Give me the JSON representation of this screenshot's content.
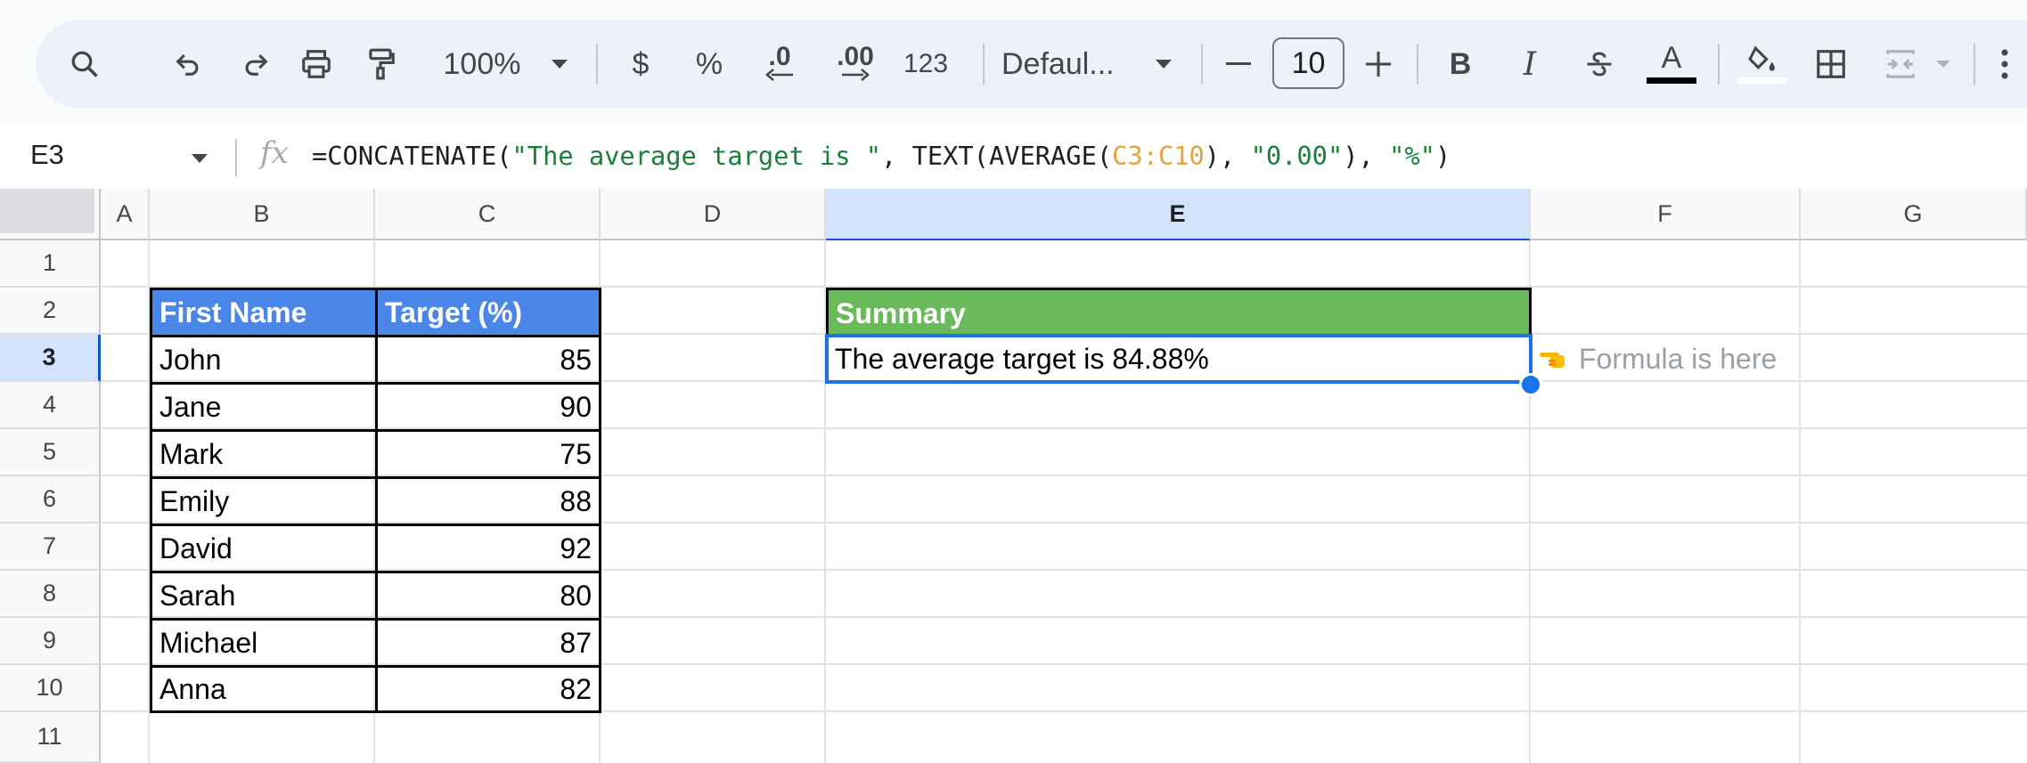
{
  "toolbar": {
    "zoom": "100%",
    "currency_label": "$",
    "percent_label": "%",
    "decrease_decimal_label": ".0",
    "increase_decimal_label": ".00",
    "number_format_label": "123",
    "font_name": "Defaul...",
    "font_size": "10",
    "bold_label": "B",
    "italic_label": "I",
    "text_color_label": "A"
  },
  "formula_bar": {
    "cell_ref": "E3",
    "fx_label": "fx",
    "formula_parts": {
      "p1": "=CONCATENATE(",
      "p2": "\"The average target is \"",
      "p3": ", TEXT(AVERAGE(",
      "p4": "C3:C10",
      "p5": "), ",
      "p6": "\"0.00\"",
      "p7": "), ",
      "p8": "\"%\"",
      "p9": ")"
    }
  },
  "columns": [
    "A",
    "B",
    "C",
    "D",
    "E",
    "F",
    "G"
  ],
  "rows": [
    "1",
    "2",
    "3",
    "4",
    "5",
    "6",
    "7",
    "8",
    "9",
    "10",
    "11"
  ],
  "table": {
    "headers": [
      "First Name",
      "Target (%)"
    ],
    "rows": [
      [
        "John",
        "85"
      ],
      [
        "Jane",
        "90"
      ],
      [
        "Mark",
        "75"
      ],
      [
        "Emily",
        "88"
      ],
      [
        "David",
        "92"
      ],
      [
        "Sarah",
        "80"
      ],
      [
        "Michael",
        "87"
      ],
      [
        "Anna",
        "82"
      ]
    ]
  },
  "summary": {
    "header": "Summary",
    "value": "The average target is 84.88%",
    "note": "Formula is here",
    "note_icon": "pointing-hand-icon"
  },
  "colors": {
    "table_header": "#4a86e8",
    "summary_header": "#6aba5c",
    "selection": "#1a73e8"
  }
}
